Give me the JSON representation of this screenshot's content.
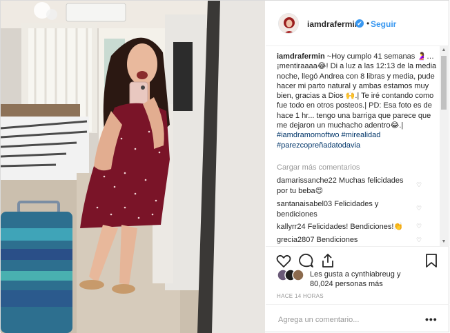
{
  "post": {
    "username": "iamdrafermin",
    "verified_badge": "✔",
    "separator": "•",
    "follow_label": "Seguir",
    "caption": {
      "username": "iamdrafermin",
      "text": "~Hoy cumplo 41 semanas 🤰… ¡mentiraaaa😂! Di a luz a las 12:13 de la media noche, llegó Andrea con 8 libras y media, pude hacer mi parto natural y ambas estamos muy bien, gracias a Dios 🙌.| Te iré contando como fue todo en otros posteos.| PD: Esa foto es de hace 1 hr... tengo una barriga que parece que me dejaron un muchacho adentro😂.|",
      "hashtags": [
        "#iamdramomoftwo",
        "#mirealidad",
        "#parezcopreñadatodavia"
      ]
    },
    "load_more_label": "Cargar más comentarios",
    "comments": [
      {
        "user": "damarissanche22",
        "text": "Muchas felicidades por tu beba😍"
      },
      {
        "user": "santanaisabel03",
        "text": "Felicidades y bendiciones"
      },
      {
        "user": "kallyrr24",
        "text": "Felicidades! Bendiciones!👏"
      },
      {
        "user": "grecia2807",
        "text": "Bendiciones"
      }
    ],
    "likes": {
      "line1": "Les gusta a cynthiabreug y",
      "line2": "80,024 personas más"
    },
    "time_ago": "HACE 14 HORAS",
    "add_comment_placeholder": "Agrega un comentario...",
    "more_options": "•••",
    "scroll_up": "▲",
    "scroll_down": "▼"
  },
  "icons": {
    "like": "heart-outline-icon",
    "comment": "comment-bubble-icon",
    "share": "share-arrow-icon",
    "save": "bookmark-icon",
    "comment_like": "small-heart-icon"
  },
  "colors": {
    "link_blue": "#3897f0",
    "hashtag": "#003569",
    "muted": "#999999",
    "dress": "#7a1428"
  }
}
